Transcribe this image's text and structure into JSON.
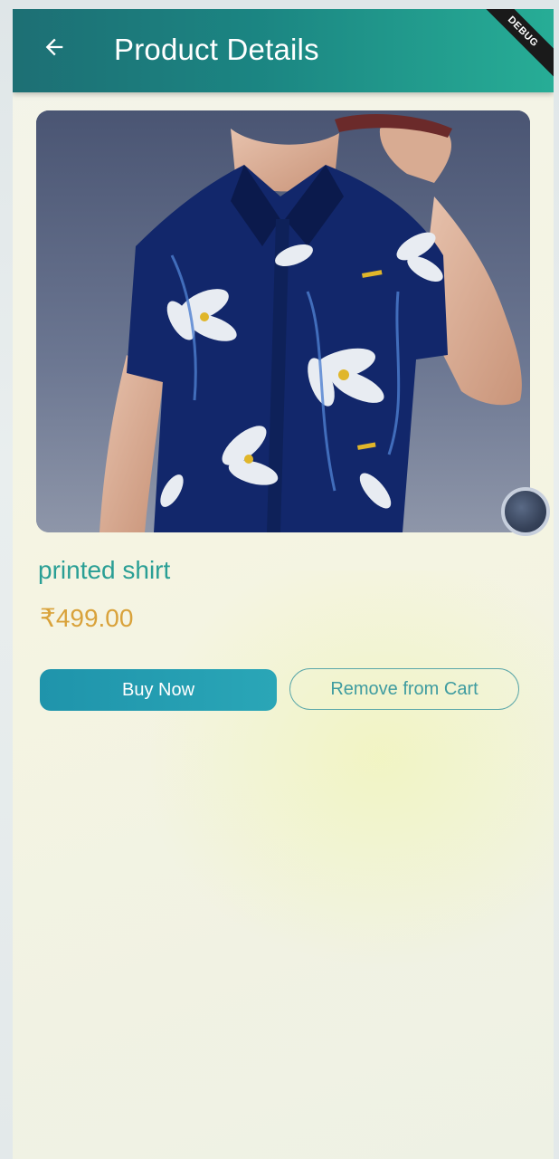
{
  "appbar": {
    "title": "Product Details",
    "back_icon": "arrow-left-icon",
    "debug_banner": "DEBUG"
  },
  "product": {
    "image_description": "Man wearing navy blue floral printed short-sleeve shirt",
    "name": "printed shirt",
    "price": "₹499.00"
  },
  "actions": {
    "buy_now": "Buy Now",
    "remove_from_cart": "Remove from Cart"
  },
  "colors": {
    "appbar_start": "#1d6f74",
    "appbar_end": "#27ad96",
    "product_name": "#2a9f95",
    "price": "#d9a23a",
    "primary_button": "#2aa6b7"
  }
}
